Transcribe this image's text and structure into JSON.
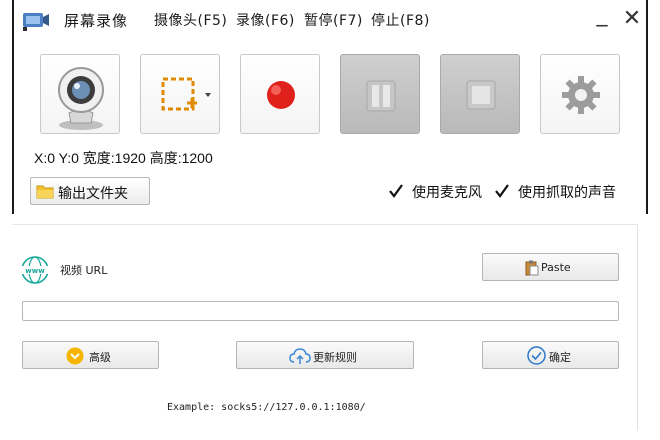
{
  "recorder": {
    "title": "屏幕录像",
    "menu": [
      {
        "label": "摄像头(F5)"
      },
      {
        "label": "录像(F6)"
      },
      {
        "label": "暂停(F7)"
      },
      {
        "label": "停止(F8)"
      }
    ],
    "window_controls": {
      "minimize": "_",
      "close": "✕"
    },
    "toolbar": [
      {
        "name": "webcam",
        "icon": "webcam-icon",
        "enabled": true
      },
      {
        "name": "region-select",
        "icon": "region-select-icon",
        "enabled": true
      },
      {
        "name": "record",
        "icon": "record-icon",
        "enabled": true
      },
      {
        "name": "pause",
        "icon": "pause-icon",
        "enabled": false
      },
      {
        "name": "stop",
        "icon": "stop-icon",
        "enabled": false
      },
      {
        "name": "settings",
        "icon": "gear-icon",
        "enabled": true
      }
    ],
    "coords_text": "X:0 Y:0 宽度:1920 高度:1200",
    "output_folder_label": "输出文件夹",
    "use_mic_label": "使用麦克风",
    "use_mic_checked": true,
    "use_system_audio_label": "使用抓取的声音",
    "use_system_audio_checked": true,
    "colors": {
      "record": "#e0201b",
      "folder": "#f2c230"
    }
  },
  "dialog": {
    "video_url_label": "视频 URL",
    "paste_label": "Paste",
    "url_value": "",
    "advanced_label": "高级",
    "update_rules_label": "更新规则",
    "ok_label": "确定",
    "example_text": "Example: socks5://127.0.0.1:1080/",
    "colors": {
      "www": "#17a89a",
      "advanced": "#f5b400",
      "ok": "#2a79c9",
      "cloud": "#3b86d6"
    }
  }
}
